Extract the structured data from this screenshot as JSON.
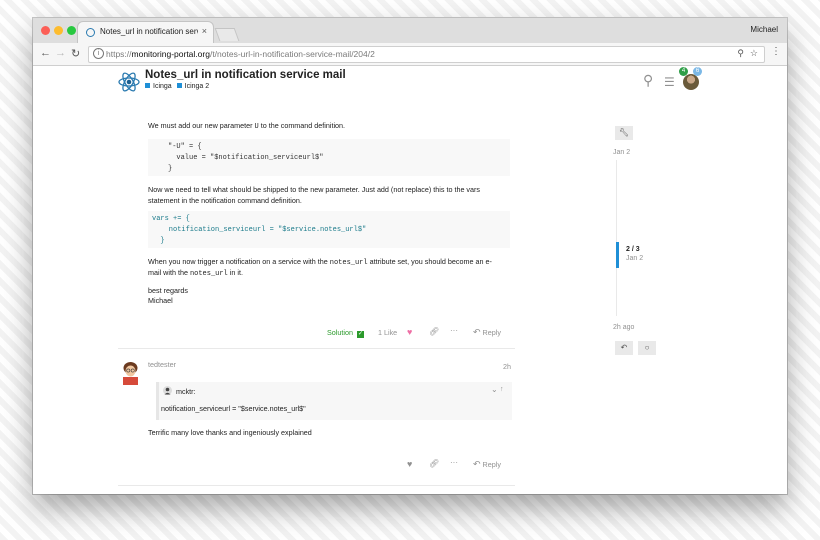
{
  "browser": {
    "tab_title": "Notes_url in notification servic",
    "tab_close": "×",
    "profile_name": "Michael",
    "url_protocol": "https://",
    "url_host": "monitoring-portal.org",
    "url_path": "/t/notes-url-in-notification-service-mail/204/2",
    "back_icon": "←",
    "forward_icon": "→",
    "reload_icon": "↻",
    "info_icon": "i",
    "search_icon": "⚲",
    "star_icon": "☆",
    "menu_icon": "⋮"
  },
  "header": {
    "topic_title": "Notes_url in notification service mail",
    "categories": [
      "Icinga",
      "Icinga 2"
    ],
    "search_icon": "⚲",
    "hamburger_icon": "☰",
    "notification_count": "4",
    "message_count": "6"
  },
  "post1": {
    "line1_a": "We must add our new parameter ",
    "line1_code": "U",
    "line1_b": " to the command definition.",
    "code1": "\"-U\" = {\n  value = \"$notification_serviceurl$\"\n}",
    "line2": "Now we need to tell what should be shipped to the new parameter. Just add (not replace) this to the vars",
    "line3": "statement in the notification command definition.",
    "code2": "vars += {\n    notification_serviceurl = \"$service.notes_url$\"\n  }",
    "line4_a": "When you now trigger a notification on a service with the ",
    "line4_code": "notes_url",
    "line4_b": " attribute set, you should become an e-",
    "line5_a": "mail with the ",
    "line5_code": "notes_url",
    "line5_b": " in it.",
    "signoff1": "best regards",
    "signoff2": "Michael",
    "solution_label": "Solution",
    "likes_label": "1 Like",
    "reply_label": "Reply"
  },
  "post2": {
    "username": "tedtester",
    "time": "2h",
    "quote_user": "mcktr:",
    "quote_text": "notification_serviceurl = \"$service.notes_url$\"",
    "body": "Terrific many love thanks and ingeniously explained",
    "reply_label": "Reply"
  },
  "timeline": {
    "top_date": "Jan 2",
    "position": "2 / 3",
    "position_date": "Jan 2",
    "bottom_date": "2h ago",
    "reply_icon": "↶",
    "circle_icon": "○"
  },
  "colors": {
    "accent": "#1f8fd6",
    "solution_green": "#2b9a2b",
    "heart_pink": "#ee6fa5",
    "notif_green": "#2f9e48",
    "msg_blue": "#7bb8e6"
  }
}
